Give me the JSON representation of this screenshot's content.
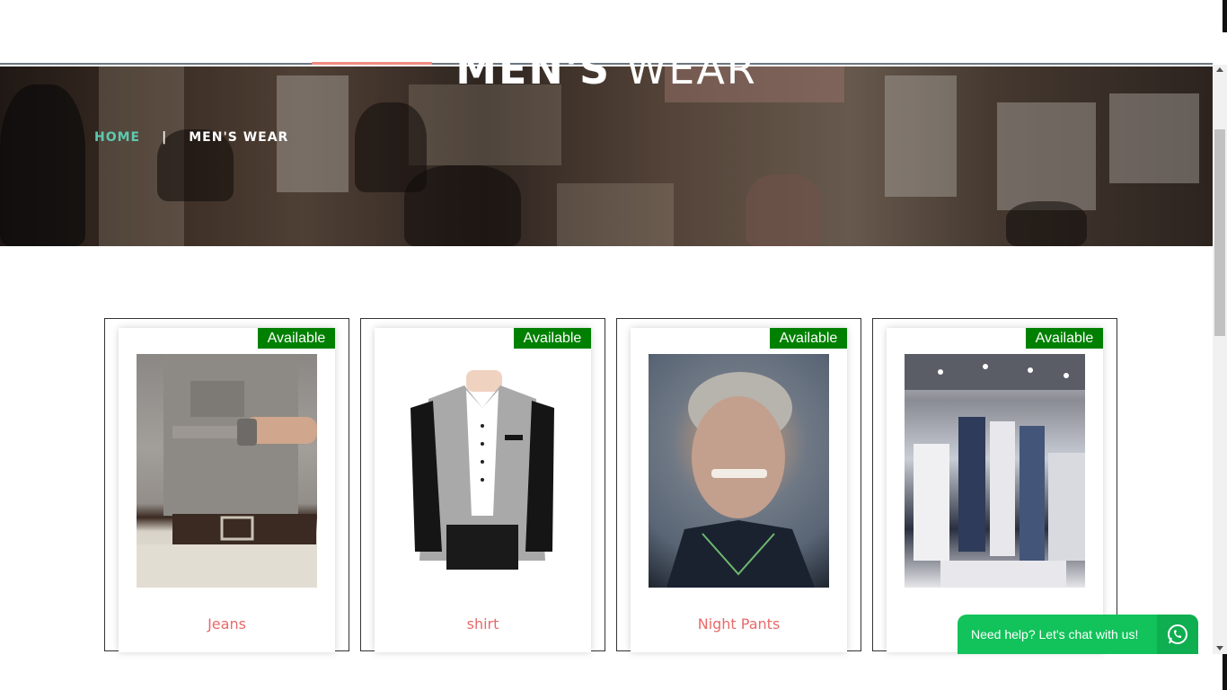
{
  "hero": {
    "title_strong": "MEN'S",
    "title_light": "WEAR"
  },
  "breadcrumb": {
    "home": "HOME",
    "separator": "|",
    "current": "MEN'S WEAR"
  },
  "products": [
    {
      "badge": "Available",
      "name": "Jeans"
    },
    {
      "badge": "Available",
      "name": "shirt"
    },
    {
      "badge": "Available",
      "name": "Night Pants"
    },
    {
      "badge": "Available",
      "name": ""
    }
  ],
  "chat": {
    "label": "Need help? Let's chat with us!",
    "icon": "whatsapp-icon"
  },
  "colors": {
    "badge": "#008000",
    "product_name": "#e86a6a",
    "breadcrumb_home": "#5ec9b0",
    "chat": "#12c25a"
  }
}
